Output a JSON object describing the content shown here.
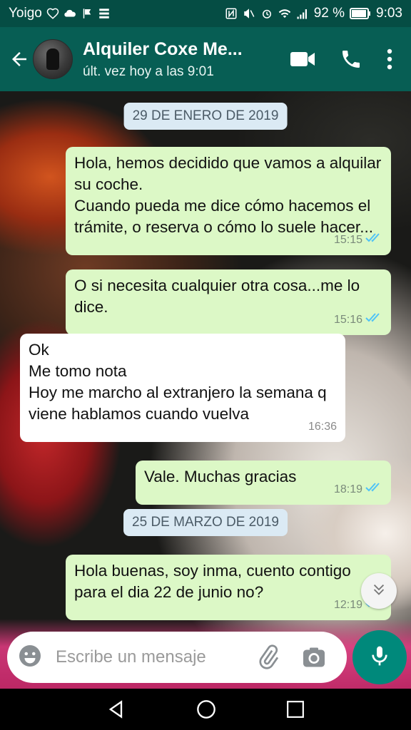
{
  "status_bar": {
    "carrier": "Yoigo",
    "battery": "92 %",
    "time": "9:03",
    "icons": [
      "heart-icon",
      "cloud-icon",
      "flag-icon",
      "grid-icon",
      "nfc-icon",
      "mute-icon",
      "alarm-icon",
      "wifi-icon",
      "signal-icon",
      "battery-icon"
    ]
  },
  "header": {
    "title": "Alquiler Coxe Me...",
    "subtitle": "últ. vez hoy a las 9:01",
    "icons": [
      "back-arrow-icon",
      "video-call-icon",
      "phone-icon",
      "more-vert-icon"
    ]
  },
  "chat": {
    "date1": "29 DE ENERO DE 2019",
    "date2": "25 DE MARZO DE 2019",
    "messages": [
      {
        "dir": "out",
        "text": "Hola, hemos decidido que vamos a alquilar su coche.\nCuando pueda me dice cómo hacemos el trámite, o reserva o cómo lo suele hacer...",
        "time": "15:15",
        "status": "read"
      },
      {
        "dir": "out",
        "text": "O si necesita cualquier otra cosa...me lo dice.",
        "time": "15:16",
        "status": "read"
      },
      {
        "dir": "in",
        "text": "Ok\nMe tomo nota\nHoy me marcho al extranjero la semana q viene hablamos cuando vuelva",
        "time": "16:36"
      },
      {
        "dir": "out",
        "text": "Vale. Muchas gracias",
        "time": "18:19",
        "status": "read"
      },
      {
        "dir": "out",
        "text": "Hola buenas, soy inma, cuento contigo para el dia 22 de junio no?",
        "time": "12:19",
        "status": "read"
      }
    ]
  },
  "composer": {
    "placeholder": "Escribe un mensaje",
    "icons": [
      "emoji-icon",
      "attach-icon",
      "camera-icon",
      "mic-icon"
    ]
  },
  "colors": {
    "header": "#075e54",
    "status_bar": "#054d44",
    "outgoing_bubble": "#dcf8c6",
    "incoming_bubble": "#ffffff",
    "date_chip": "#dbeaf4",
    "read_ticks": "#4fc3f7",
    "mic_button": "#00897b"
  }
}
